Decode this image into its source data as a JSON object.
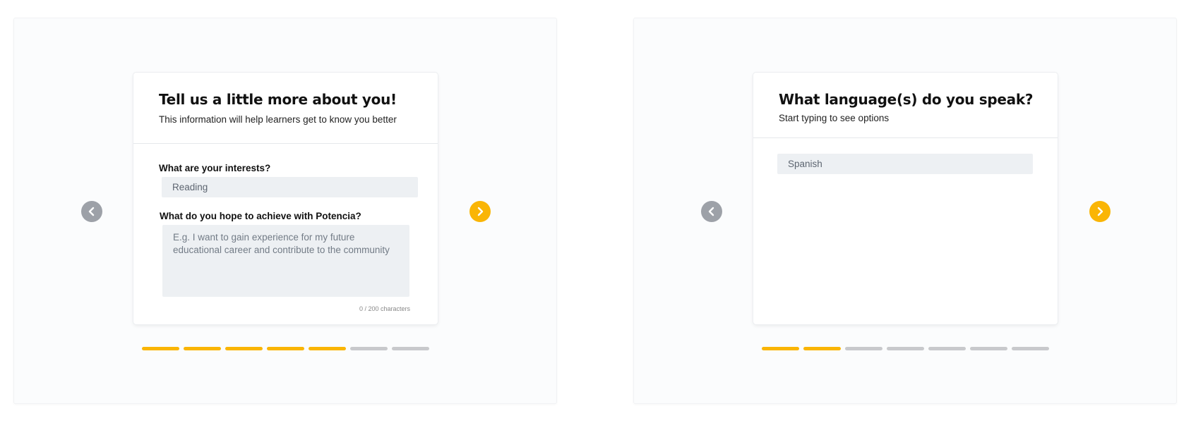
{
  "step1": {
    "title": "Tell us a little more about you!",
    "subtitle": "This information will help learners get to know you better",
    "interests_label": "What are your interests?",
    "interests_value": "Reading",
    "goal_label": "What do you hope to achieve with Potencia?",
    "goal_placeholder": "E.g. I want to gain experience for my future educational career and contribute to the community",
    "char_counter": "0 / 200 characters",
    "progress": {
      "completed": 5,
      "total": 7
    }
  },
  "step2": {
    "title": "What language(s) do you speak?",
    "subtitle": "Start typing to see options",
    "language_value": "Spanish",
    "progress": {
      "completed": 2,
      "total": 7
    }
  },
  "nav": {
    "prev_icon": "chevron-left-icon",
    "next_icon": "chevron-right-icon"
  },
  "colors": {
    "accent": "#fab505",
    "nav_disabled": "#9da1a8",
    "progress_inactive": "#c8c9cc",
    "input_bg": "#edf0f3"
  }
}
